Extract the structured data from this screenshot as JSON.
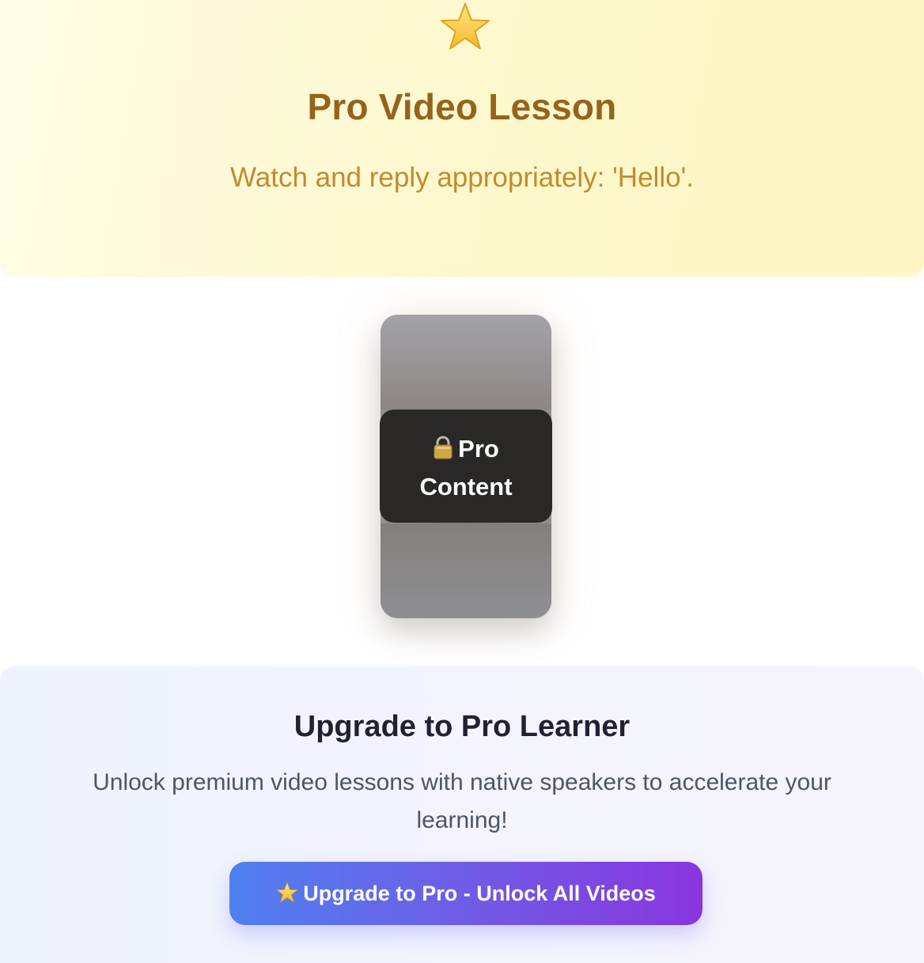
{
  "hero": {
    "icon": "star-icon",
    "title": "Pro Video Lesson",
    "subtitle": "Watch and reply appropriately: 'Hello'."
  },
  "video": {
    "lock_icon": "lock-icon",
    "lock_label_line1": "Pro",
    "lock_label_line2": "Content"
  },
  "upgrade": {
    "title": "Upgrade to Pro Learner",
    "description": "Unlock premium video lessons with native speakers to accelerate your learning!",
    "button_icon": "star-icon",
    "button_label": "Upgrade to Pro - Unlock All Videos"
  },
  "colors": {
    "hero_title": "#96621c",
    "hero_subtitle": "#c48a2c",
    "button_gradient_start": "#4f80f0",
    "button_gradient_end": "#8a35de"
  }
}
